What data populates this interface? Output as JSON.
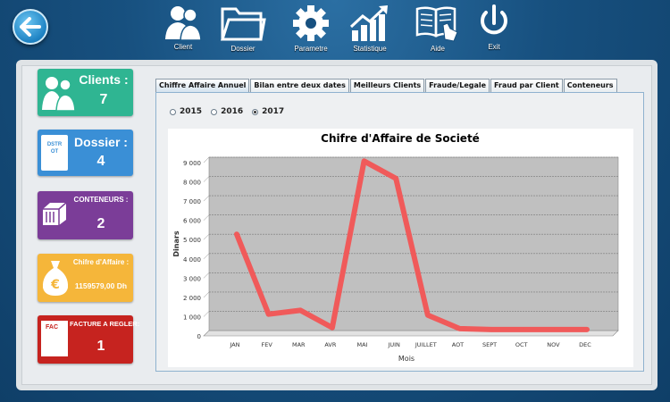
{
  "toolbar": {
    "items": [
      {
        "label": "Client",
        "icon": "user-group-icon"
      },
      {
        "label": "Dossier",
        "icon": "folder-icon"
      },
      {
        "label": "Parametre",
        "icon": "gear-icon"
      },
      {
        "label": "Statistique",
        "icon": "chart-icon"
      },
      {
        "label": "Aide",
        "icon": "book-icon"
      },
      {
        "label": "Exit",
        "icon": "power-icon"
      }
    ]
  },
  "cards": {
    "clients": {
      "title": "Clients :",
      "value": "7",
      "color": "#2fb592"
    },
    "dossier": {
      "title": "Dossier :",
      "value": "4",
      "icon_text": "DSTR OT",
      "color": "#3a8fd6"
    },
    "conteneurs": {
      "title": "CONTENEURS :",
      "value": "2",
      "color": "#7b3d98"
    },
    "chiffre": {
      "title": "Chifre d'Affaire :",
      "value": "1159579,00 Dh",
      "color": "#f5b63a"
    },
    "facture": {
      "title": "FACTURE A REGLER:",
      "value": "1",
      "icon_text": "FAC",
      "color": "#c6231f"
    }
  },
  "tabs": [
    {
      "label": "Chiffre Affaire Annuel",
      "active": true
    },
    {
      "label": "Bilan entre deux dates",
      "active": false
    },
    {
      "label": "Meilleurs Clients",
      "active": false
    },
    {
      "label": "Fraude/Legale",
      "active": false
    },
    {
      "label": "Fraud par Client",
      "active": false
    },
    {
      "label": "Conteneurs",
      "active": false
    }
  ],
  "years": [
    {
      "label": "2015",
      "selected": false
    },
    {
      "label": "2016",
      "selected": false
    },
    {
      "label": "2017",
      "selected": true
    }
  ],
  "chart_data": {
    "type": "line",
    "title": "Chifre d'Affaire de Societé",
    "xlabel": "Mois",
    "ylabel": "Dinars",
    "categories": [
      "JAN",
      "FEV",
      "MAR",
      "AVR",
      "MAI",
      "JUIN",
      "JUILLET",
      "AOT",
      "SEPT",
      "OCT",
      "NOV",
      "DEC"
    ],
    "values": [
      5000,
      850,
      1050,
      150,
      8800,
      7900,
      800,
      100,
      50,
      50,
      50,
      50
    ],
    "yticks": [
      "0",
      "1 000",
      "2 000",
      "3 000",
      "4 000",
      "5 000",
      "6 000",
      "7 000",
      "8 000",
      "9 000"
    ],
    "ylim": [
      0,
      9000
    ],
    "line_color": "#f05a5a",
    "plot_bg": "#c0c0c0",
    "grid": true
  }
}
